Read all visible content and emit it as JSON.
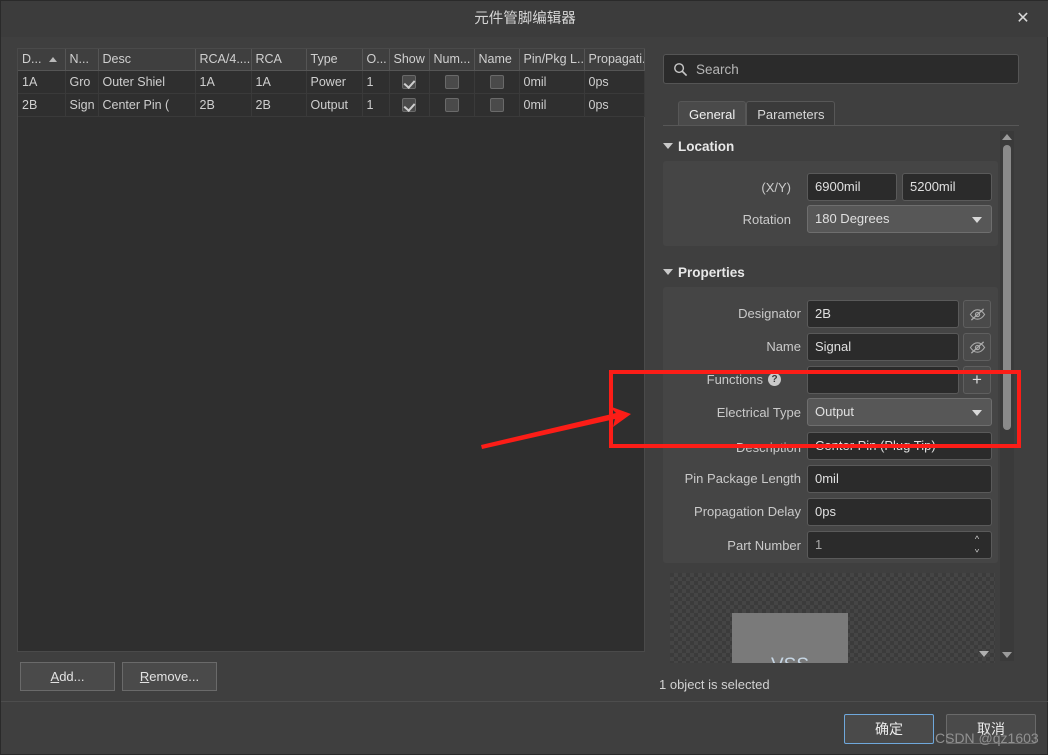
{
  "window": {
    "title": "元件管脚编辑器",
    "close_icon": "close-icon"
  },
  "pin_table": {
    "columns": [
      "D...",
      "N...",
      "Desc",
      "RCA/4....",
      "RCA",
      "Type",
      "O...",
      "Show",
      "Num...",
      "Name",
      "Pin/Pkg L...",
      "Propagati..."
    ],
    "sorted_column_index": 0,
    "rows": [
      {
        "designator": "1A",
        "name": "Gro",
        "desc": "Outer Shiel",
        "rca4": "1A",
        "rca": "1A",
        "type": "Power",
        "owner": "1",
        "show": true,
        "number_visible": false,
        "name_visible": false,
        "pin_pkg_length": "0mil",
        "propagation_delay": "0ps"
      },
      {
        "designator": "2B",
        "name": "Sign",
        "desc": "Center Pin (",
        "rca4": "2B",
        "rca": "2B",
        "type": "Output",
        "owner": "1",
        "show": true,
        "number_visible": false,
        "name_visible": false,
        "pin_pkg_length": "0mil",
        "propagation_delay": "0ps"
      }
    ]
  },
  "table_buttons": {
    "add": "Add...",
    "add_mnemonic": "A",
    "add_rest": "dd...",
    "remove": "Remove...",
    "remove_mnemonic": "R",
    "remove_rest": "emove..."
  },
  "search": {
    "placeholder": "Search",
    "value": "",
    "icon": "search-icon"
  },
  "tabs": [
    {
      "label": "General",
      "active": true
    },
    {
      "label": "Parameters",
      "active": false
    }
  ],
  "location": {
    "heading": "Location",
    "xy_label": "(X/Y)",
    "x_value": "6900mil",
    "y_value": "5200mil",
    "rotation_label": "Rotation",
    "rotation_value": "180 Degrees"
  },
  "properties": {
    "heading": "Properties",
    "designator_label": "Designator",
    "designator_value": "2B",
    "name_label": "Name",
    "name_value": "Signal",
    "functions_label": "Functions",
    "functions_value": "",
    "functions_help": "?",
    "functions_add": "+",
    "electrical_type_label": "Electrical Type",
    "electrical_type_value": "Output",
    "description_label": "Description",
    "description_value": "Center Pin (Plug Tip)",
    "pin_package_length_label": "Pin Package Length",
    "pin_package_length_value": "0mil",
    "propagation_delay_label": "Propagation Delay",
    "propagation_delay_value": "0ps",
    "part_number_label": "Part Number",
    "part_number_value": "1"
  },
  "preview": {
    "symbol_label": "VSS"
  },
  "status": {
    "text": "1 object is selected"
  },
  "dialog_buttons": {
    "ok": "确定",
    "cancel": "取消"
  },
  "watermark": {
    "text": "CSDN @qz1603"
  },
  "annotations": {
    "highlight_color": "#fc1d17"
  }
}
